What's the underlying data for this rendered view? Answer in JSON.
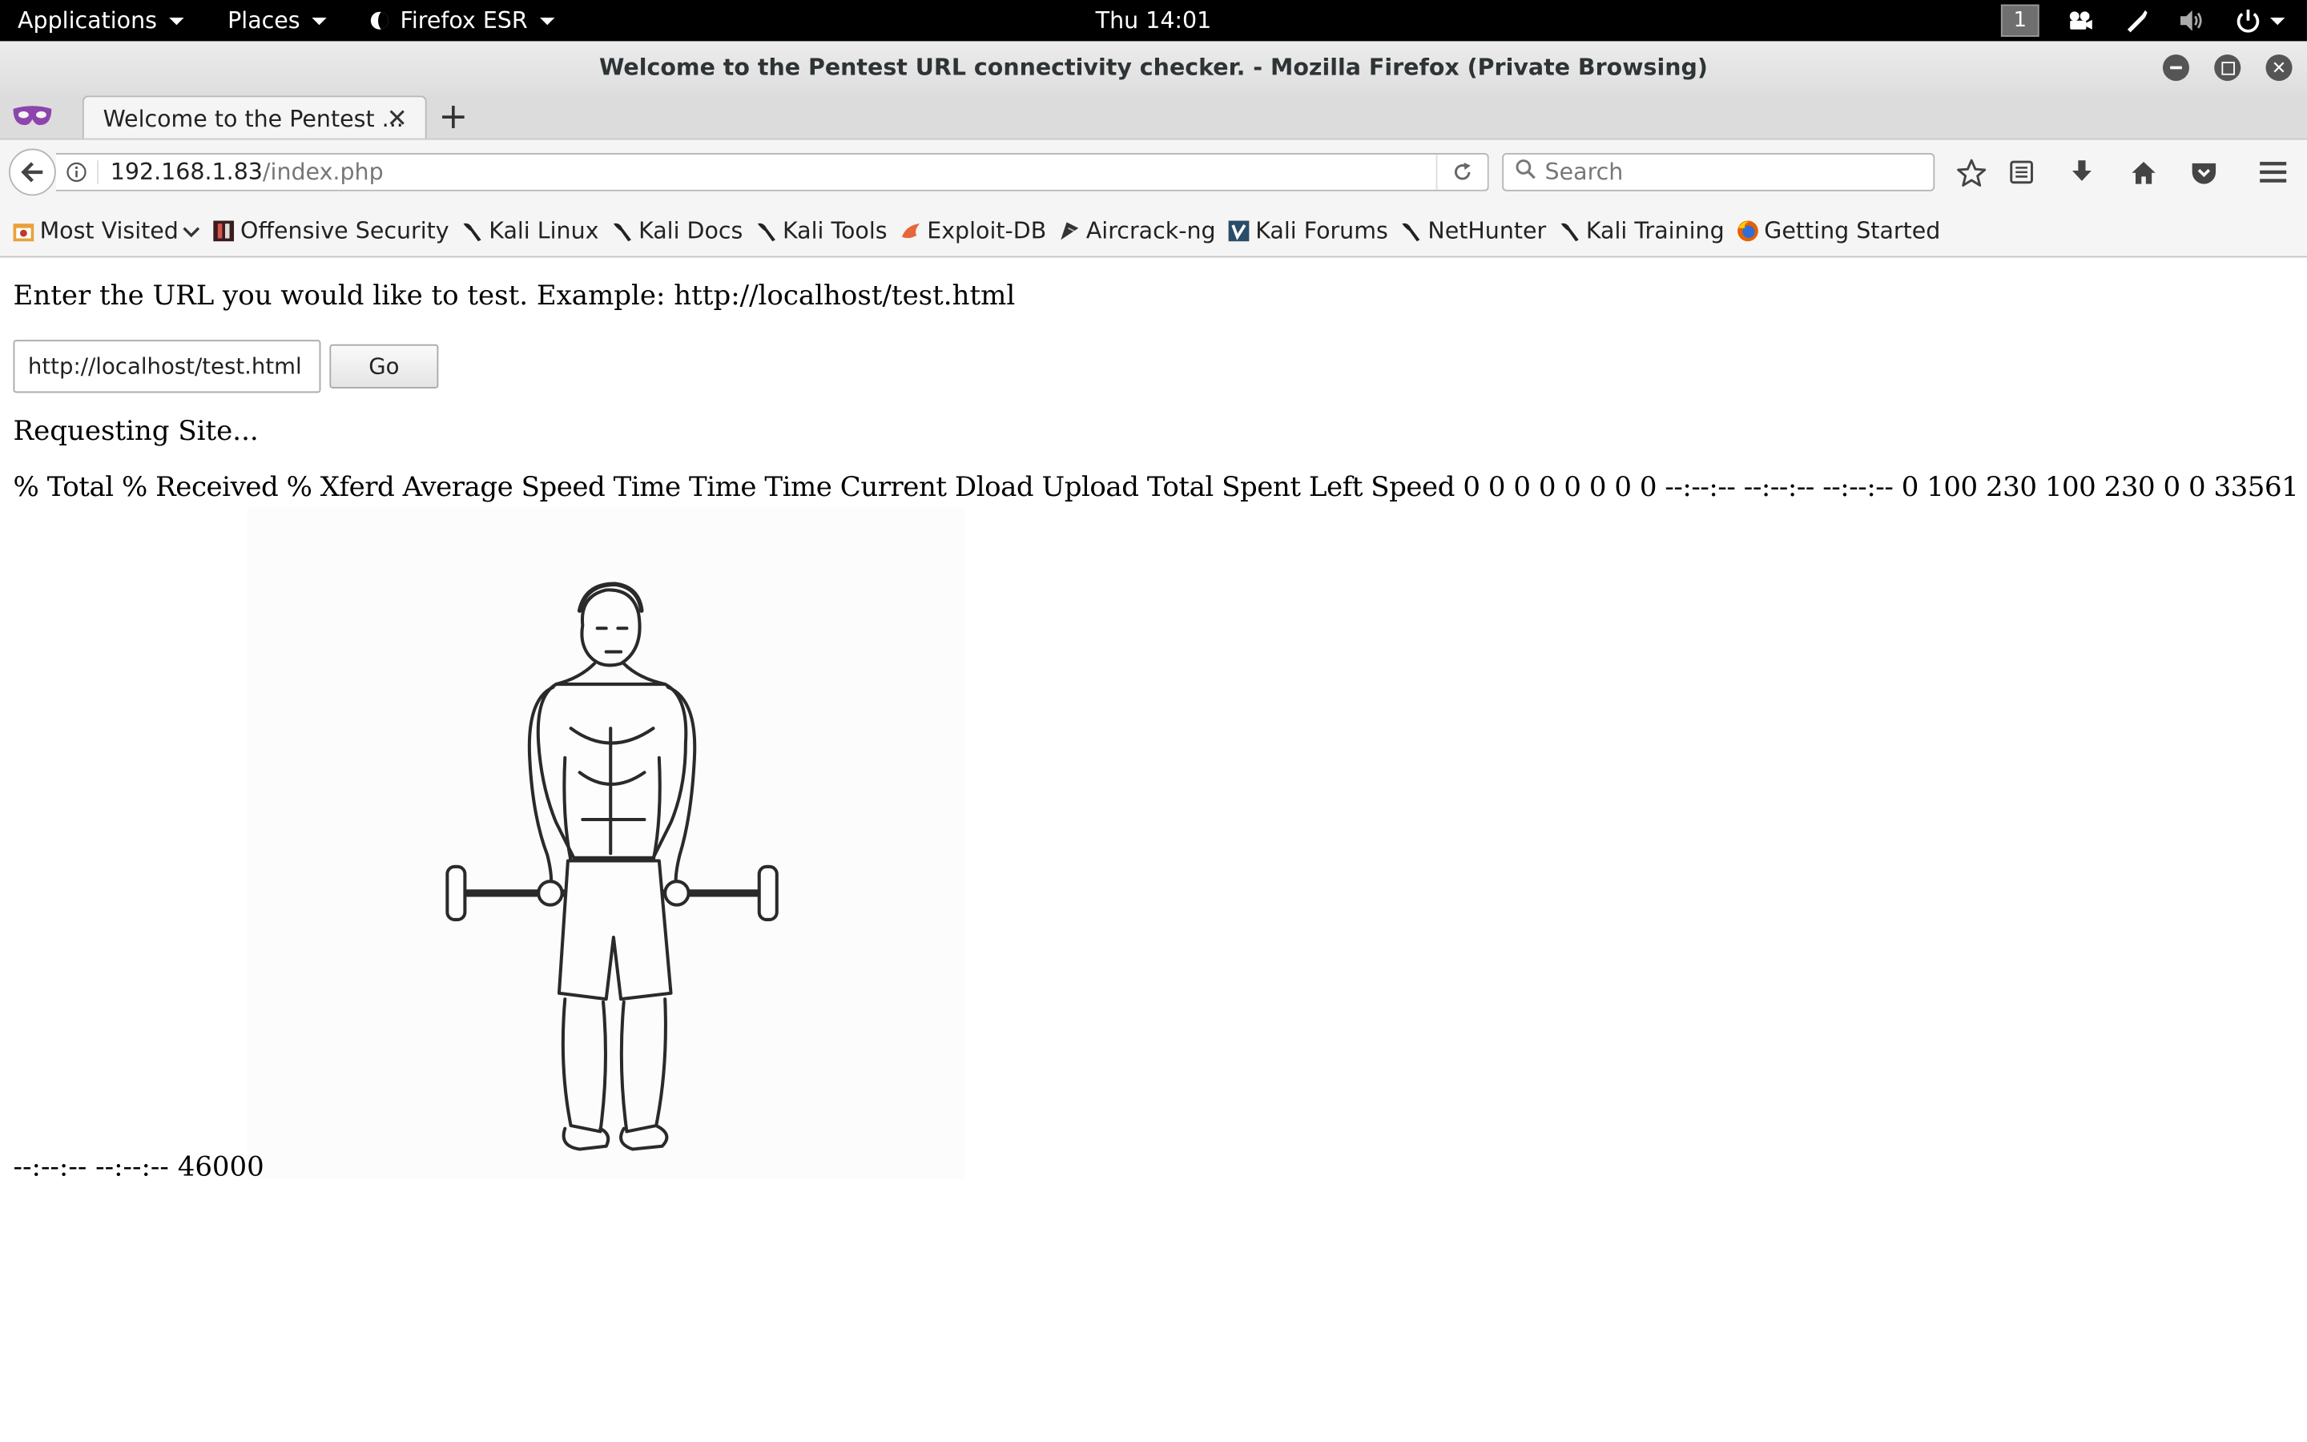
{
  "topbar": {
    "applications": "Applications",
    "places": "Places",
    "firefox": "Firefox ESR",
    "clock": "Thu 14:01",
    "workspace": "1"
  },
  "window": {
    "title": "Welcome to the Pentest URL connectivity checker. - Mozilla Firefox (Private Browsing)"
  },
  "tab": {
    "label": "Welcome to the Pentest ..."
  },
  "navbar": {
    "url_host": "192.168.1.83",
    "url_path": "/index.php",
    "search_placeholder": "Search"
  },
  "bookmarks": [
    {
      "label": "Most Visited",
      "icon": "most-visited-icon"
    },
    {
      "label": "Offensive Security",
      "icon": "offsec-icon"
    },
    {
      "label": "Kali Linux",
      "icon": "kali-dragon-icon"
    },
    {
      "label": "Kali Docs",
      "icon": "kali-dragon-icon"
    },
    {
      "label": "Kali Tools",
      "icon": "kali-dragon-icon"
    },
    {
      "label": "Exploit-DB",
      "icon": "exploit-db-icon"
    },
    {
      "label": "Aircrack-ng",
      "icon": "aircrack-icon"
    },
    {
      "label": "Kali Forums",
      "icon": "kali-forums-icon"
    },
    {
      "label": "NetHunter",
      "icon": "kali-dragon-icon"
    },
    {
      "label": "Kali Training",
      "icon": "kali-dragon-icon"
    },
    {
      "label": "Getting Started",
      "icon": "firefox-icon"
    }
  ],
  "page": {
    "prompt": "Enter the URL you would like to test. Example: http://localhost/test.html",
    "input_value": "http://localhost/test.html",
    "go_label": "Go",
    "requesting": "Requesting Site...",
    "curl_output": "% Total % Received % Xferd Average Speed Time Time Time Current Dload Upload Total Spent Left Speed 0 0 0 0 0 0 0 0 --:--:-- --:--:-- --:--:-- 0 100 230 100 230 0 0 33561 0 --:--:--",
    "curl_output_tail": "--:--:-- --:--:-- 46000"
  }
}
